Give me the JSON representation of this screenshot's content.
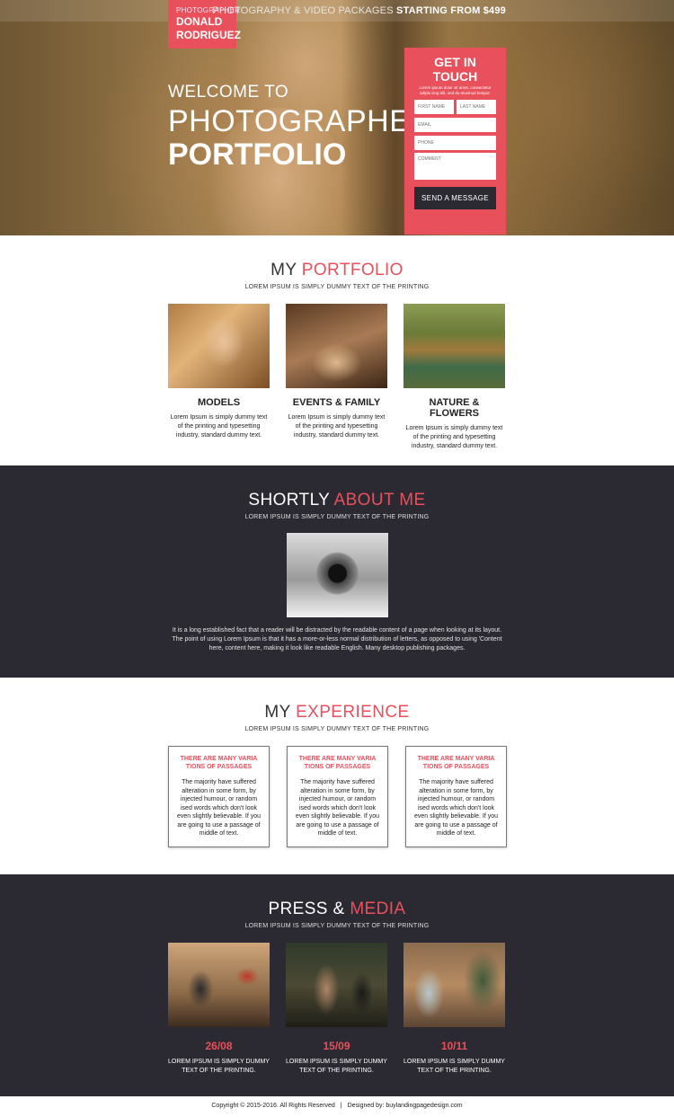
{
  "hero": {
    "role": "PHOTOGRAPHER",
    "name_line1": "DONALD",
    "name_line2": "RODRIGUEZ",
    "packages_text": "PHOTOGRAPHY & VIDEO PACKAGES",
    "packages_price": "STARTING FROM $499",
    "welcome": "WELCOME TO",
    "title_line1": "PHOTOGRAPHER'S",
    "title_line2": "PORTFOLIO"
  },
  "form": {
    "title": "GET IN TOUCH",
    "subtitle": "Lorem ipsum dolor sit amet, consectetur adipis cing elit, sed do eiusmod tempor.",
    "first_name_placeholder": "FIRST NAME",
    "last_name_placeholder": "LAST NAME",
    "email_placeholder": "EMAIL",
    "phone_placeholder": "PHONE",
    "comment_placeholder": "COMMENT",
    "submit_label": "SEND A MESSAGE"
  },
  "portfolio": {
    "title_plain": "MY",
    "title_accent": "PORTFOLIO",
    "subtitle": "LOREM IPSUM IS SIMPLY DUMMY TEXT OF THE PRINTING",
    "items": [
      {
        "title": "MODELS",
        "text": "Lorem Ipsum is simply dummy text of the printing and typesetting industry, standard dummy text."
      },
      {
        "title": "EVENTS & FAMILY",
        "text": "Lorem Ipsum is simply dummy text of the printing and typesetting industry, standard dummy text."
      },
      {
        "title": "NATURE & FLOWERS",
        "text": "Lorem Ipsum is simply dummy text of the printing and typesetting industry, standard dummy text."
      }
    ]
  },
  "about": {
    "title_plain": "SHORTLY",
    "title_accent": "ABOUT ME",
    "subtitle": "LOREM IPSUM IS SIMPLY DUMMY TEXT OF THE PRINTING",
    "paragraph": "It is a long established fact that a reader will be distracted by the readable content of a page when looking at its layout. The point of using Lorem Ipsum is that it has a more-or-less normal distribution of letters, as opposed to using 'Content here, content here, making it look like readable English. Many desktop publishing packages."
  },
  "experience": {
    "title_plain": "MY",
    "title_accent": "EXPERIENCE",
    "subtitle": "LOREM IPSUM IS SIMPLY DUMMY TEXT OF THE PRINTING",
    "items": [
      {
        "title": "THERE ARE MANY VARIA TIONS OF PASSAGES",
        "text": "The majority have suffered alteration in some form, by injected humour, or random ised words which don't look even slightly believable. If you are going to use a passage of middle of text."
      },
      {
        "title": "THERE ARE MANY VARIA TIONS OF PASSAGES",
        "text": "The majority have suffered alteration in some form, by injected humour, or random ised words which don't look even slightly believable. If you are going to use a passage of middle of text."
      },
      {
        "title": "THERE ARE MANY VARIA TIONS OF PASSAGES",
        "text": "The majority have suffered alteration in some form, by injected humour, or random ised words which don't look even slightly believable. If you are going to use a passage of middle of text."
      }
    ]
  },
  "press": {
    "title_plain": "PRESS &",
    "title_accent": "MEDIA",
    "subtitle": "LOREM IPSUM IS SIMPLY DUMMY TEXT OF THE PRINTING",
    "items": [
      {
        "date": "26/08",
        "text": "LOREM IPSUM IS SIMPLY DUMMY TEXT OF THE PRINTING."
      },
      {
        "date": "15/09",
        "text": "LOREM IPSUM IS SIMPLY DUMMY TEXT OF THE PRINTING."
      },
      {
        "date": "10/11",
        "text": "LOREM IPSUM IS SIMPLY DUMMY TEXT OF THE PRINTING."
      }
    ]
  },
  "footer": {
    "copyright": "Copyright © 2015-2016. All Rights Reserved",
    "separator": "|",
    "designed_by": "Designed by: buylandingpagedesign.com"
  },
  "colors": {
    "accent": "#e8505b",
    "dark": "#2b2a33"
  }
}
